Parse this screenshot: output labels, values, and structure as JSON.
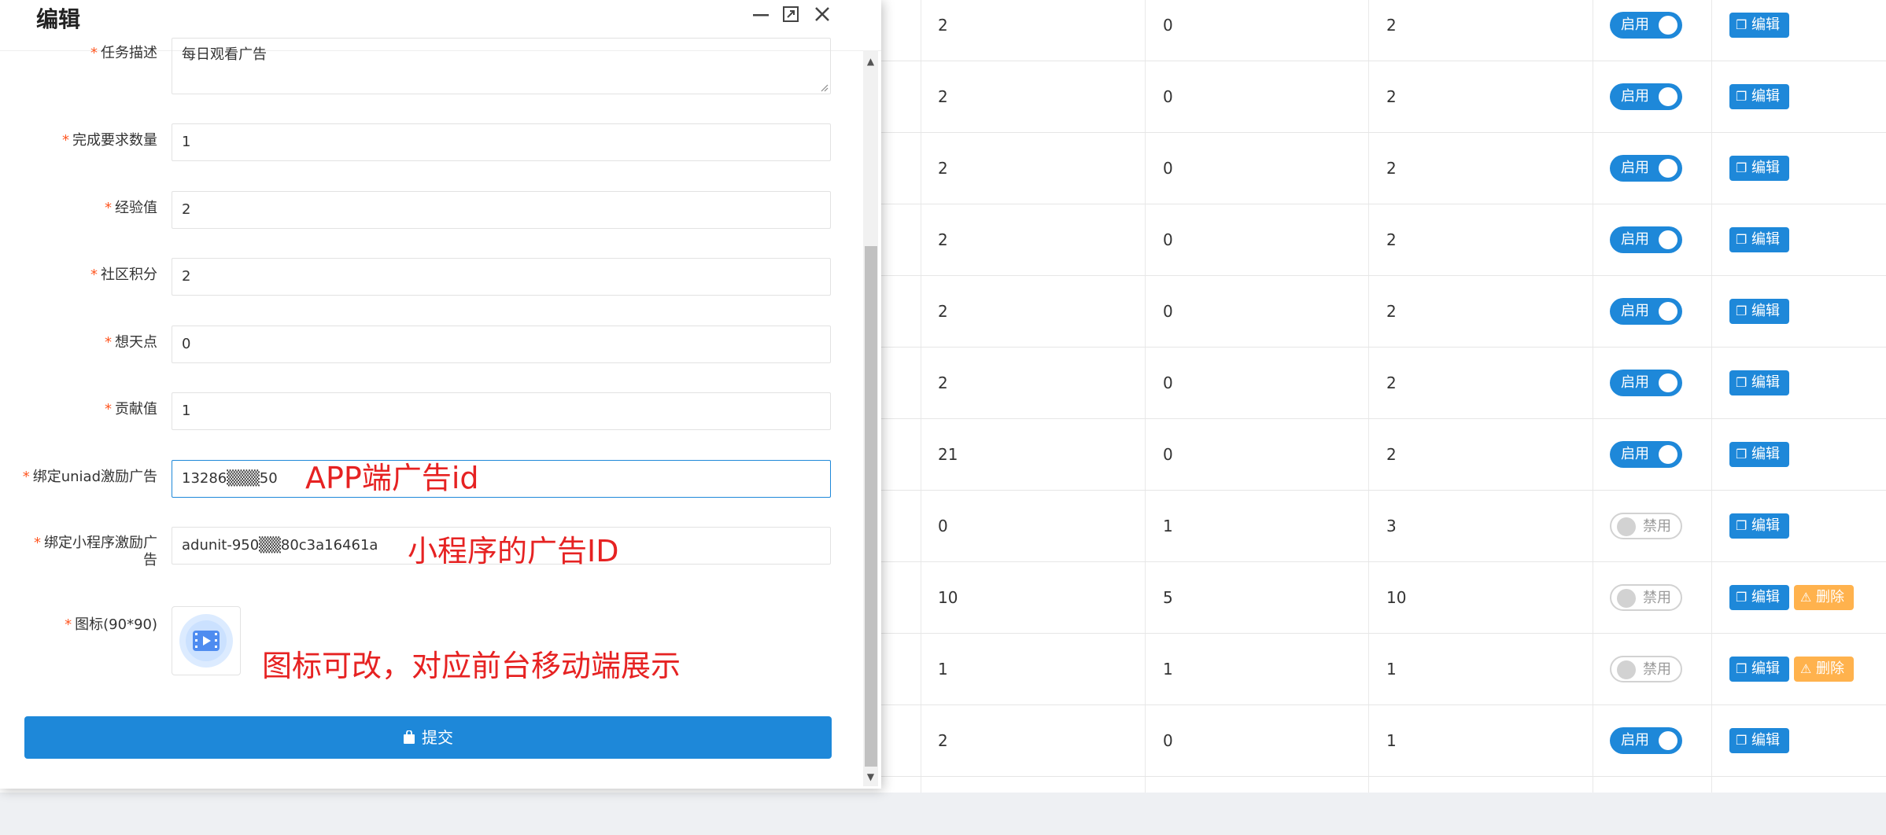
{
  "background_table": {
    "rows": [
      {
        "c1": "2",
        "c2": "0",
        "c3": "2",
        "status": "启用",
        "on": true,
        "actions": [
          "编辑"
        ]
      },
      {
        "c1": "2",
        "c2": "0",
        "c3": "2",
        "status": "启用",
        "on": true,
        "actions": [
          "编辑"
        ]
      },
      {
        "c1": "2",
        "c2": "0",
        "c3": "2",
        "status": "启用",
        "on": true,
        "actions": [
          "编辑"
        ]
      },
      {
        "c1": "2",
        "c2": "0",
        "c3": "2",
        "status": "启用",
        "on": true,
        "actions": [
          "编辑"
        ]
      },
      {
        "c1": "2",
        "c2": "0",
        "c3": "2",
        "status": "启用",
        "on": true,
        "actions": [
          "编辑"
        ]
      },
      {
        "c1": "2",
        "c2": "0",
        "c3": "2",
        "status": "启用",
        "on": true,
        "actions": [
          "编辑"
        ]
      },
      {
        "c1": "21",
        "c2": "0",
        "c3": "2",
        "status": "启用",
        "on": true,
        "actions": [
          "编辑"
        ]
      },
      {
        "c1": "0",
        "c2": "1",
        "c3": "3",
        "status": "禁用",
        "on": false,
        "actions": [
          "编辑"
        ]
      },
      {
        "c1": "10",
        "c2": "5",
        "c3": "10",
        "status": "禁用",
        "on": false,
        "actions": [
          "编辑",
          "删除"
        ]
      },
      {
        "c1": "1",
        "c2": "1",
        "c3": "1",
        "status": "禁用",
        "on": false,
        "actions": [
          "编辑",
          "删除"
        ]
      },
      {
        "c1": "2",
        "c2": "0",
        "c3": "1",
        "status": "启用",
        "on": true,
        "actions": [
          "编辑"
        ]
      }
    ]
  },
  "dialog": {
    "title": "编辑",
    "partial_label": "任务描述",
    "partial_value": "每日观看广告",
    "fields": [
      {
        "label": "完成要求数量",
        "value": "1"
      },
      {
        "label": "经验值",
        "value": "2"
      },
      {
        "label": "社区积分",
        "value": "2"
      },
      {
        "label": "想天点",
        "value": "0"
      },
      {
        "label": "贡献值",
        "value": "1"
      },
      {
        "label": "绑定uniad激励广告",
        "value": "13286▒▒▒50"
      },
      {
        "label_line1": "绑定小程序激励广",
        "label_line2": "告",
        "value": "adunit-950▒▒80c3a16461a"
      }
    ],
    "icon_label": "图标(90*90)",
    "submit_label": "提交",
    "required_mark": "*"
  },
  "annotations": {
    "app_ad": "APP端广告id",
    "mini_ad": "小程序的广告ID",
    "icon_note": "图标可改，对应前台移动端展示"
  },
  "colors": {
    "primary": "#1E88D9",
    "warning": "#FFB24D",
    "annotation": "#E62222",
    "required": "#FF5722"
  }
}
